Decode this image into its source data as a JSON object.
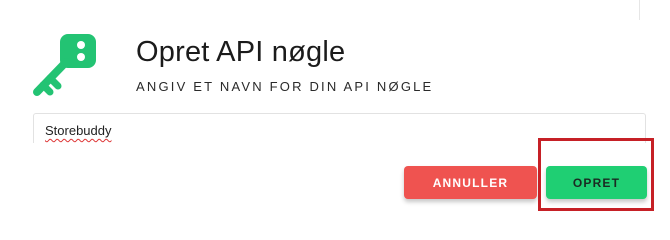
{
  "header": {
    "title": "Opret API nøgle",
    "subtitle": "ANGIV ET NAVN FOR DIN API NØGLE",
    "icon": "key-icon",
    "icon_color": "#23c373"
  },
  "form": {
    "name_value": "Storebuddy"
  },
  "actions": {
    "cancel_label": "ANNULLER",
    "create_label": "OPRET",
    "cancel_color": "#ef5350",
    "create_color": "#1fcf73"
  },
  "highlight": {
    "color": "#c62026"
  }
}
